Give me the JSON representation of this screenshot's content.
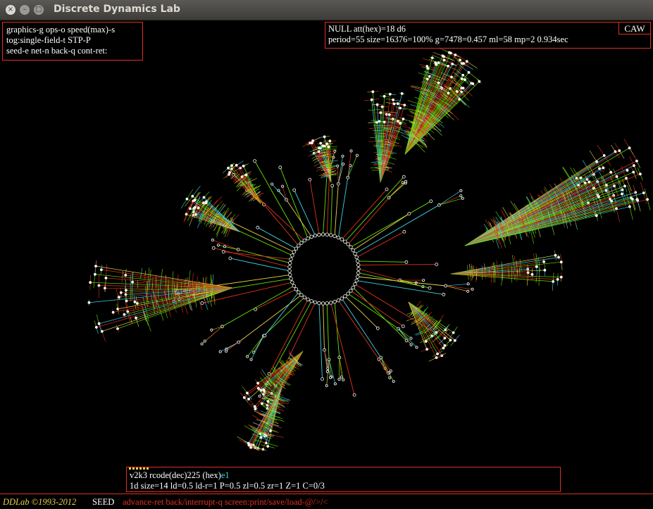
{
  "window": {
    "title": "Discrete Dynamics Lab",
    "buttons": {
      "close": "×",
      "minimize": "–",
      "maximize": "□"
    }
  },
  "menu": {
    "lines": [
      "graphics-g ops-o speed(max)-s",
      "tog:single-field-t STP-P",
      "seed-e net-n back-q cont-ret:"
    ]
  },
  "attractor": {
    "line1": "NULL att(hex)=18 d6",
    "line2": "period=55 size=16376=100% g=7478=0.457 ml=58 mp=2  0.934sec",
    "mode_tag": "CAW"
  },
  "rule": {
    "prefix": "v2k3 rcode(dec)225  (hex)",
    "hex": "e1",
    "line2": "1d size=14 ld=0.5 ld-r=1 P=0.5 zl=0.5 zr=1 Z=1 C=0/3"
  },
  "status": {
    "logo": "DDLab ©1993-2012",
    "mode": "SEED",
    "keys": "advance-ret back/interrupt-q  screen:print/save/load-@/>/<"
  },
  "colors": {
    "background": "#000000",
    "panel_border": "#e0301e",
    "edge_red": "#e0301e",
    "edge_green": "#66e000",
    "edge_yellow": "#e8d24a",
    "edge_cyan": "#3ad4e8",
    "node_white": "#ffffff"
  },
  "icons": [
    "close-icon",
    "minimize-icon",
    "maximize-icon"
  ]
}
